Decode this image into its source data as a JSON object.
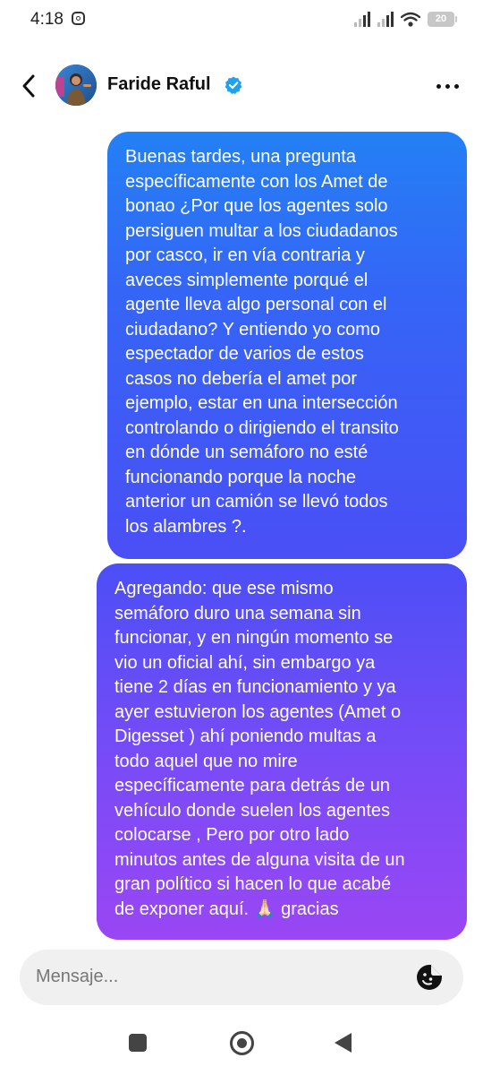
{
  "status_bar": {
    "time": "4:18",
    "battery": "20"
  },
  "header": {
    "contact_name": "Faride Raful",
    "verified": true
  },
  "messages": [
    {
      "sender": "me",
      "lines": [
        "Buenas tardes, una pregunta",
        "específicamente con los Amet de",
        "bonao ¿Por que los agentes solo",
        "persiguen multar a los ciudadanos",
        "por casco, ir en vía contraria y",
        "aveces simplemente porqué el",
        "agente lleva algo personal con el",
        "ciudadano? Y entiendo yo como",
        "espectador de varios de estos",
        "casos no debería el amet por",
        "ejemplo, estar en una intersección",
        "controlando o dirigiendo el transito",
        "en dónde un semáforo no esté",
        "funcionando porque la noche",
        "anterior un camión se llevó todos",
        "los alambres ?."
      ]
    },
    {
      "sender": "me",
      "lines": [
        "Agregando: que ese mismo",
        "semáforo duro una semana sin",
        "funcionar, y en ningún momento se",
        "vio un oficial ahí, sin embargo ya",
        "tiene 2 días en funcionamiento y ya",
        "ayer estuvieron los agentes (Amet o",
        "Digesset ) ahí poniendo multas a",
        "todo aquel que no mire",
        "específicamente para detrás de un",
        "vehículo donde suelen los agentes",
        "colocarse , Pero por otro lado",
        "minutos antes de alguna visita de un",
        "gran político si hacen lo que acabé",
        "de exponer aquí. 🙏🏻 gracias"
      ]
    }
  ],
  "composer": {
    "placeholder": "Mensaje..."
  },
  "icons": {
    "back": "chevron-left-icon",
    "verified": "verified-badge-icon",
    "more": "more-horizontal-icon",
    "sticker": "sticker-icon"
  },
  "colors": {
    "bubble_gradient_top": "#1596f3",
    "bubble_gradient_mid": "#4a4ff6",
    "bubble_gradient_bottom": "#9a46f4",
    "verified_badge": "#1da1f2",
    "composer_bg": "#f0f0f0"
  }
}
